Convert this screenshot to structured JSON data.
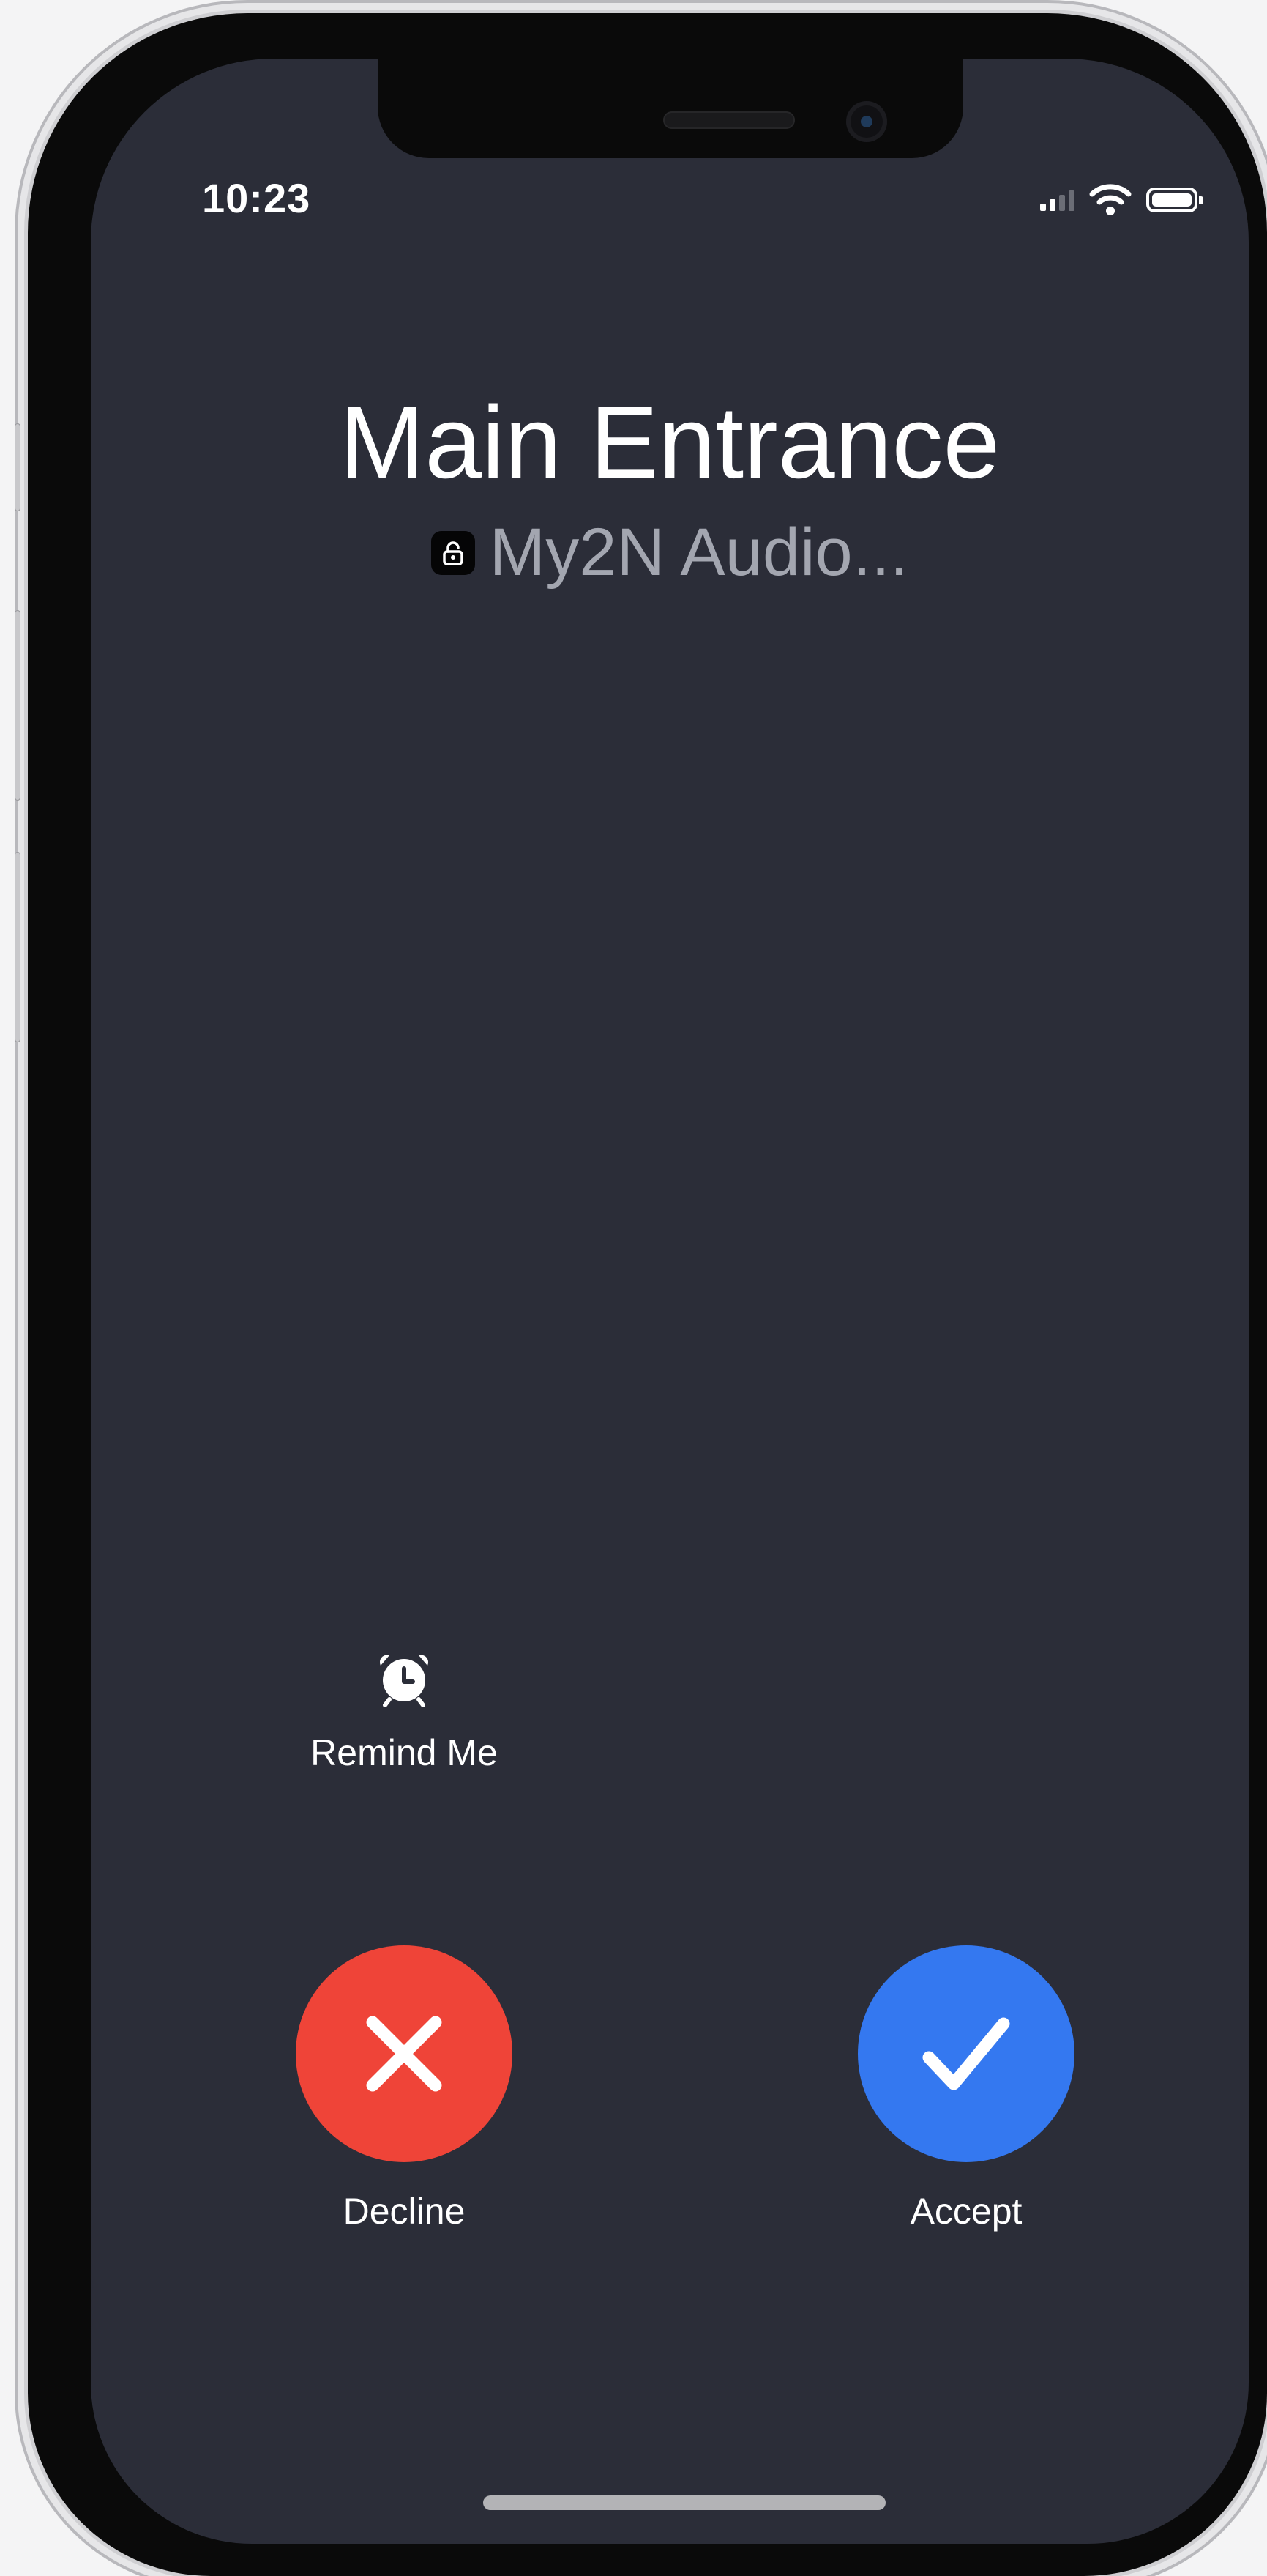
{
  "status_bar": {
    "time": "10:23",
    "icons": [
      "signal-icon",
      "wifi-icon",
      "battery-icon"
    ],
    "signal_bars": 2
  },
  "call": {
    "caller_name": "Main Entrance",
    "app_icon": "lock-icon",
    "app_name": "My2N Audio..."
  },
  "actions": {
    "remind": {
      "label": "Remind Me",
      "icon": "alarm-clock-icon"
    },
    "decline": {
      "label": "Decline",
      "icon": "close-icon",
      "color": "#ef4438"
    },
    "accept": {
      "label": "Accept",
      "icon": "checkmark-icon",
      "color": "#3478f0"
    }
  },
  "colors": {
    "background": "#2b2d38",
    "text": "#ffffff",
    "secondary_text": "#a3a6b0"
  }
}
